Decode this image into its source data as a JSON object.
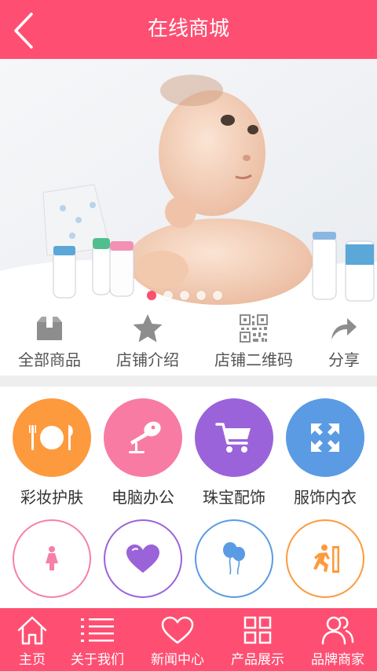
{
  "header": {
    "title": "在线商城",
    "back_icon": "chevron-left-icon"
  },
  "banner": {
    "slide_count": 5,
    "active_slide": 1
  },
  "quick_links": [
    {
      "label": "全部商品",
      "icon": "box-icon"
    },
    {
      "label": "店铺介绍",
      "icon": "star-icon"
    },
    {
      "label": "店铺二维码",
      "icon": "qr-code-icon"
    },
    {
      "label": "分享",
      "icon": "share-icon"
    }
  ],
  "categories": [
    {
      "label": "彩妆护肤",
      "icon": "plate-cutlery-icon",
      "color": "#fd9a3d"
    },
    {
      "label": "电脑办公",
      "icon": "microphone-icon",
      "color": "#f77ba3"
    },
    {
      "label": "珠宝配饰",
      "icon": "shopping-cart-icon",
      "color": "#9b63d9"
    },
    {
      "label": "服饰内衣",
      "icon": "expand-arrows-icon",
      "color": "#5a9be3"
    }
  ],
  "category_row2": [
    {
      "icon": "woman-icon",
      "color": "#f680aa"
    },
    {
      "icon": "heart-icon",
      "color": "#9b63d9"
    },
    {
      "icon": "balloons-icon",
      "color": "#5a9be3"
    },
    {
      "icon": "running-man-icon",
      "color": "#fd9a3d"
    }
  ],
  "tabbar": {
    "items": [
      {
        "label": "主页",
        "icon": "home-icon"
      },
      {
        "label": "关于我们",
        "icon": "list-icon"
      },
      {
        "label": "新闻中心",
        "icon": "heart-outline-icon"
      },
      {
        "label": "产品展示",
        "icon": "grid-icon"
      },
      {
        "label": "品牌商家",
        "icon": "users-icon"
      }
    ]
  },
  "colors": {
    "brand": "#fe4f72",
    "divider": "#eeeeee"
  }
}
